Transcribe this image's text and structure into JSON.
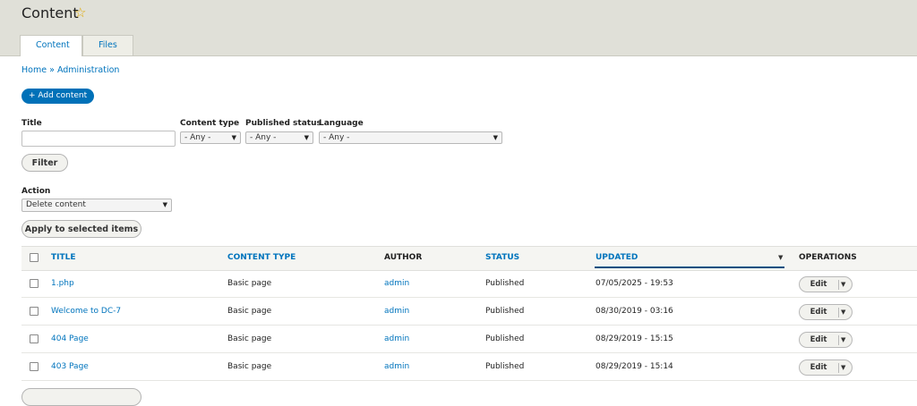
{
  "header": {
    "title": "Content",
    "star_icon": "star-icon",
    "tabs": [
      {
        "label": "Content",
        "active": true
      },
      {
        "label": "Files",
        "active": false
      }
    ]
  },
  "breadcrumb": {
    "home": "Home",
    "separator": "»",
    "admin": "Administration"
  },
  "add_button": "+ Add content",
  "filters": {
    "title_label": "Title",
    "title_value": "",
    "content_type_label": "Content type",
    "content_type_value": "- Any -",
    "published_label": "Published status",
    "published_value": "- Any -",
    "language_label": "Language",
    "language_value": "- Any -",
    "filter_button": "Filter"
  },
  "action": {
    "label": "Action",
    "value": "Delete content",
    "apply_button": "Apply to selected items"
  },
  "table": {
    "columns": [
      "TITLE",
      "CONTENT TYPE",
      "AUTHOR",
      "STATUS",
      "UPDATED",
      "OPERATIONS"
    ],
    "rows": [
      {
        "title": "1.php",
        "type": "Basic page",
        "author": "admin",
        "status": "Published",
        "updated": "07/05/2025 - 19:53",
        "op": "Edit"
      },
      {
        "title": "Welcome to DC-7",
        "type": "Basic page",
        "author": "admin",
        "status": "Published",
        "updated": "08/30/2019 - 03:16",
        "op": "Edit"
      },
      {
        "title": "404 Page",
        "type": "Basic page",
        "author": "admin",
        "status": "Published",
        "updated": "08/29/2019 - 15:15",
        "op": "Edit"
      },
      {
        "title": "403 Page",
        "type": "Basic page",
        "author": "admin",
        "status": "Published",
        "updated": "08/29/2019 - 15:14",
        "op": "Edit"
      }
    ]
  },
  "colors": {
    "link": "#0074bd",
    "primary_button": "#0071b8",
    "header_bg": "#e0e0d8"
  }
}
